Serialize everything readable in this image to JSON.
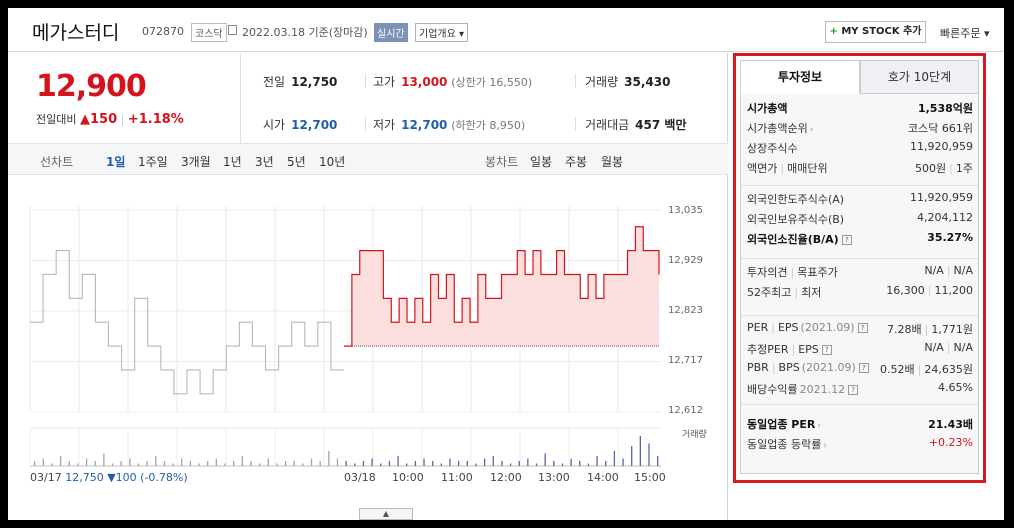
{
  "header": {
    "name": "메가스터디",
    "code": "072870",
    "market": "코스닥",
    "date": "2022.03.18 기준(장마감)",
    "realtime": "실시간",
    "overview": "기업개요 ▾",
    "mystock": "MY STOCK 추가",
    "mystock_plus": "+",
    "quick_order": "빠른주문 ▾"
  },
  "price": {
    "current": "12,900",
    "change_label": "전일대비",
    "change_value": "▲150",
    "change_sep": "|",
    "change_pct": "+1.18%"
  },
  "summary": {
    "prev_label": "전일",
    "prev_value": "12,750",
    "high_label": "고가",
    "high_value": "13,000",
    "upper_limit": "(상한가 16,550)",
    "volume_label": "거래량",
    "volume_value": "35,430",
    "open_label": "시가",
    "open_value": "12,700",
    "low_label": "저가",
    "low_value": "12,700",
    "lower_limit": "(하한가 8,950)",
    "amount_label": "거래대금",
    "amount_value": "457 백만"
  },
  "tabs": {
    "line_label": "선차트",
    "periods": [
      "1일",
      "1주일",
      "3개월",
      "1년",
      "3년",
      "5년",
      "10년"
    ],
    "candle_label": "봉차트",
    "candles": [
      "일봉",
      "주봉",
      "월봉"
    ]
  },
  "chart_data": {
    "type": "line",
    "y_ticks": [
      "13,035",
      "12,929",
      "12,823",
      "12,717",
      "12,612"
    ],
    "ylim": [
      12612,
      13035
    ],
    "x_ticks": [
      "03/18",
      "10:00",
      "11:00",
      "12:00",
      "13:00",
      "14:00",
      "15:00"
    ],
    "previous_day": {
      "date": "03/17",
      "close": "12,750",
      "change": "▼100",
      "pct": "(-0.78%)"
    },
    "volume_label": "거래량",
    "series": [
      {
        "x": [
          "03/17",
          "03/17",
          "03/17",
          "03/17",
          "03/17",
          "03/17",
          "03/17",
          "03/17",
          "03/17",
          "03/17",
          "03/17",
          "03/17",
          "03/17",
          "03/17",
          "03/17",
          "03/17",
          "03/17",
          "03/17",
          "03/17",
          "03/17",
          "03/17",
          "03/17",
          "03/17",
          "03/17",
          "03/17"
        ],
        "values": [
          12800,
          12900,
          12950,
          12850,
          12900,
          12800,
          12750,
          12700,
          12850,
          12750,
          12700,
          12650,
          12700,
          12650,
          12700,
          12750,
          12800,
          12750,
          12700,
          12750,
          12800,
          12750,
          12800,
          12700,
          12700
        ]
      },
      {
        "name": "03/18",
        "x": [
          "09:00",
          "09:05",
          "09:10",
          "09:20",
          "09:30",
          "09:40",
          "09:50",
          "10:00",
          "10:10",
          "10:20",
          "10:30",
          "10:40",
          "10:50",
          "11:00",
          "11:10",
          "11:20",
          "11:30",
          "11:40",
          "11:50",
          "12:00",
          "12:10",
          "12:20",
          "12:30",
          "12:40",
          "12:50",
          "13:00",
          "13:10",
          "13:20",
          "13:30",
          "13:40",
          "13:50",
          "14:00",
          "14:10",
          "14:20",
          "14:30",
          "14:40",
          "14:50",
          "15:00",
          "15:10",
          "15:20",
          "15:30"
        ],
        "values": [
          12750,
          12900,
          12950,
          12950,
          12950,
          12850,
          12800,
          12850,
          12800,
          12850,
          12800,
          12900,
          12850,
          12900,
          12800,
          12850,
          12800,
          12900,
          12850,
          12850,
          12900,
          12900,
          12950,
          12900,
          12950,
          12900,
          12900,
          12950,
          12900,
          12900,
          12850,
          12900,
          12850,
          12900,
          12900,
          12900,
          12950,
          13000,
          12950,
          12950,
          12900
        ]
      }
    ],
    "volume": [
      2,
      3,
      1,
      4,
      2,
      1,
      3,
      2,
      5,
      1,
      2,
      3,
      1,
      2,
      4,
      2,
      1,
      3,
      2,
      1,
      2,
      3,
      1,
      2,
      4,
      2,
      1,
      3,
      1,
      2,
      2,
      1,
      3,
      2,
      6,
      3,
      2,
      1,
      2,
      3,
      1,
      2,
      4,
      1,
      2,
      3,
      2,
      1,
      3,
      2,
      2,
      1,
      3,
      4,
      2,
      1,
      2,
      3,
      1,
      5,
      2,
      1,
      3,
      2,
      1,
      4,
      2,
      6,
      3,
      8,
      12,
      9,
      4
    ],
    "grid": true
  },
  "panel": {
    "tab_active": "투자정보",
    "tab_other": "호가 10단계",
    "s1": [
      {
        "l": "시가총액",
        "r": "1,538억원",
        "bold": true
      },
      {
        "l": "시가총액순위",
        "r": "코스닥 661위",
        "arrow": true
      },
      {
        "l": "상장주식수",
        "r": "11,920,959"
      },
      {
        "l": "액면가",
        "l2": "매매단위",
        "r": "500원",
        "r2": "1주"
      }
    ],
    "s2": [
      {
        "l": "외국인한도주식수(A)",
        "r": "11,920,959"
      },
      {
        "l": "외국인보유주식수(B)",
        "r": "4,204,112"
      },
      {
        "l": "외국인소진율(B/A)",
        "r": "35.27%",
        "bold": true,
        "q": true
      }
    ],
    "s3": [
      {
        "l": "투자의견",
        "l2": "목표주가",
        "r": "N/A",
        "r2": "N/A"
      },
      {
        "l": "52주최고",
        "l2": "최저",
        "r": "16,300",
        "r2": "11,200"
      }
    ],
    "s4": [
      {
        "l": "PER",
        "l2": "EPS",
        "l3": "(2021.09)",
        "r": "7.28배",
        "r2": "1,771원",
        "q": true
      },
      {
        "l": "추정PER",
        "l2": "EPS",
        "r": "N/A",
        "r2": "N/A",
        "q": true
      },
      {
        "l": "PBR",
        "l2": "BPS",
        "l3": "(2021.09)",
        "r": "0.52배",
        "r2": "24,635원",
        "q": true
      },
      {
        "l": "배당수익률",
        "l3": "2021.12",
        "r": "4.65%",
        "q": true
      }
    ],
    "s5": [
      {
        "l": "동일업종 PER",
        "r": "21.43배",
        "bold": true,
        "arrow": true
      },
      {
        "l": "동일업종 등락률",
        "r": "+0.23%",
        "red": true,
        "arrow": true
      }
    ]
  }
}
